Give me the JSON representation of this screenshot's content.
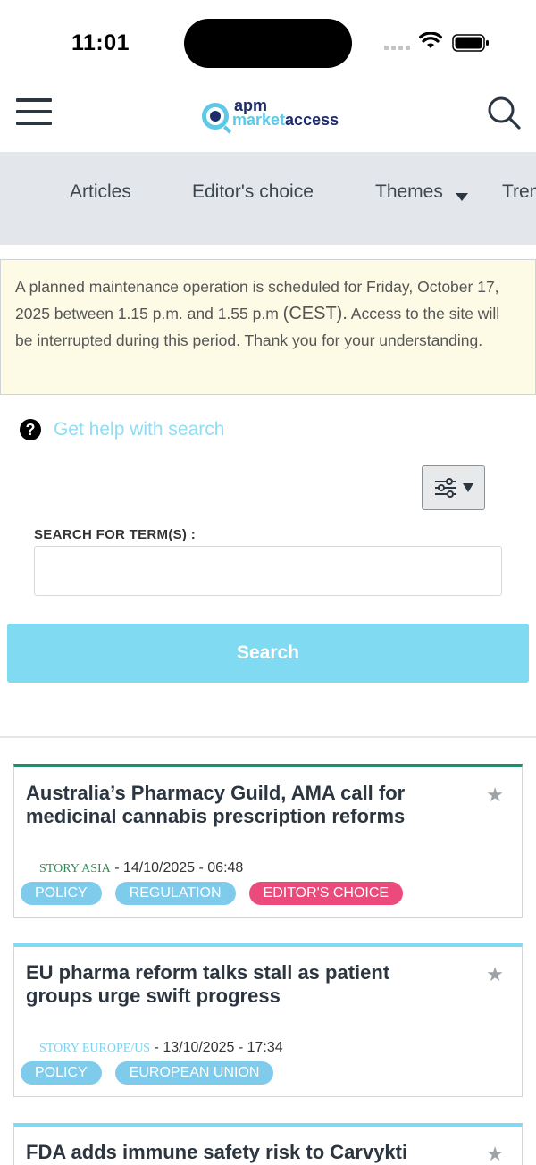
{
  "status": {
    "time": "11:01"
  },
  "header": {
    "logo_apm": "apm",
    "logo_market": "market",
    "logo_access": "access"
  },
  "nav": {
    "items": [
      "Articles",
      "Editor's choice",
      "Themes",
      "Trending"
    ]
  },
  "notice": {
    "text_a": "A planned maintenance operation is scheduled for Friday, October 17, 2025 between 1.15 p.m. and 1.55 p.m",
    "text_cest": "(CEST).",
    "text_b": "Access to the site will be interrupted during this period. Thank you for your understanding."
  },
  "help": {
    "icon": "?",
    "label": "Get help with search"
  },
  "search": {
    "label": "SEARCH FOR TERM(S) :",
    "value": "",
    "button": "Search"
  },
  "articles": [
    {
      "title": "Australia’s Pharmacy Guild, AMA call for medicinal cannabis prescription reforms",
      "story": "STORY ASIA",
      "story_color": "#2e8b57",
      "date": "- 14/10/2025 - 06:48",
      "accent": "#1f8f6a",
      "tags": [
        "POLICY",
        "REGULATION",
        "EDITOR'S CHOICE"
      ]
    },
    {
      "title": "EU pharma reform talks stall as patient groups urge swift progress",
      "story": "STORY EUROPE/US",
      "story_color": "#7fd0ec",
      "date": "- 13/10/2025 - 17:34",
      "accent": "#7fdaf2",
      "tags": [
        "POLICY",
        "EUROPEAN UNION"
      ]
    },
    {
      "title": "FDA adds immune safety risk to Carvykti",
      "accent": "#7fdaf2"
    }
  ],
  "colors": {
    "accent_blue": "#7fdaf2",
    "editor_choice": "#ea4b7c",
    "navy": "#1d2c6b"
  }
}
